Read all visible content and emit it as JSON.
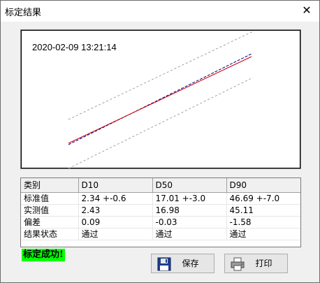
{
  "window": {
    "title": "标定结果",
    "close_glyph": "✕"
  },
  "plot": {
    "timestamp": "2020-02-09 13:21:14"
  },
  "table": {
    "headers": [
      "类别",
      "D10",
      "D50",
      "D90"
    ],
    "rows": [
      [
        "标准值",
        "2.34 +-0.6",
        "17.01 +-3.0",
        "46.69 +-7.0"
      ],
      [
        "实测值",
        "2.43",
        "16.98",
        "45.11"
      ],
      [
        "偏差",
        "0.09",
        "-0.03",
        "-1.58"
      ],
      [
        "结果状态",
        "通过",
        "通过",
        "通过"
      ]
    ]
  },
  "status": {
    "text": "标定成功!",
    "bg": "#00ff00"
  },
  "buttons": {
    "save_label": "保存",
    "print_label": "打印"
  },
  "colors": {
    "fit_line": "#cc0000",
    "measured_line": "#000080",
    "bound_line": "#a0a0a0"
  }
}
